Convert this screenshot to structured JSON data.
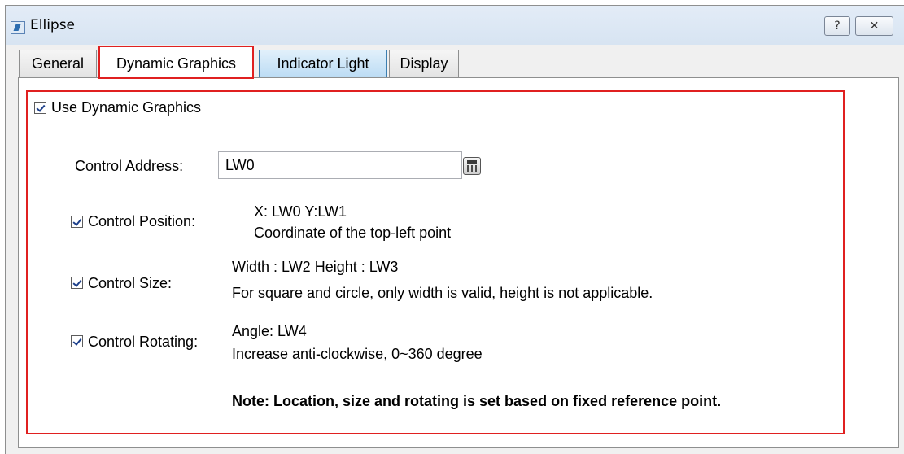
{
  "window": {
    "title": "Ellipse",
    "help_label": "?",
    "close_label": "✕"
  },
  "tabs": [
    {
      "label": "General"
    },
    {
      "label": "Dynamic Graphics"
    },
    {
      "label": "Indicator Light"
    },
    {
      "label": "Display"
    }
  ],
  "dynamic": {
    "use_label": "Use Dynamic Graphics",
    "use_checked": true,
    "control_address_label": "Control Address:",
    "control_address_value": "LW0",
    "position": {
      "label": "Control Position:",
      "checked": true,
      "line1": "X: LW0   Y:LW1",
      "line2": "Coordinate of the top-left point"
    },
    "size": {
      "label": "Control Size:",
      "checked": true,
      "line1": "Width : LW2   Height : LW3",
      "line2": "For square and circle, only width is valid, height is not applicable."
    },
    "rotating": {
      "label": "Control Rotating:",
      "checked": true,
      "line1": "Angle: LW4",
      "line2": "Increase anti-clockwise, 0~360 degree"
    },
    "note": "Note: Location, size and rotating is set based on fixed reference point."
  },
  "colors": {
    "highlight": "#e02020",
    "active_tab_blue": "#3c7fb1"
  },
  "icons": {
    "window": "ellipse-app-icon",
    "calculator": "keypad-icon"
  }
}
